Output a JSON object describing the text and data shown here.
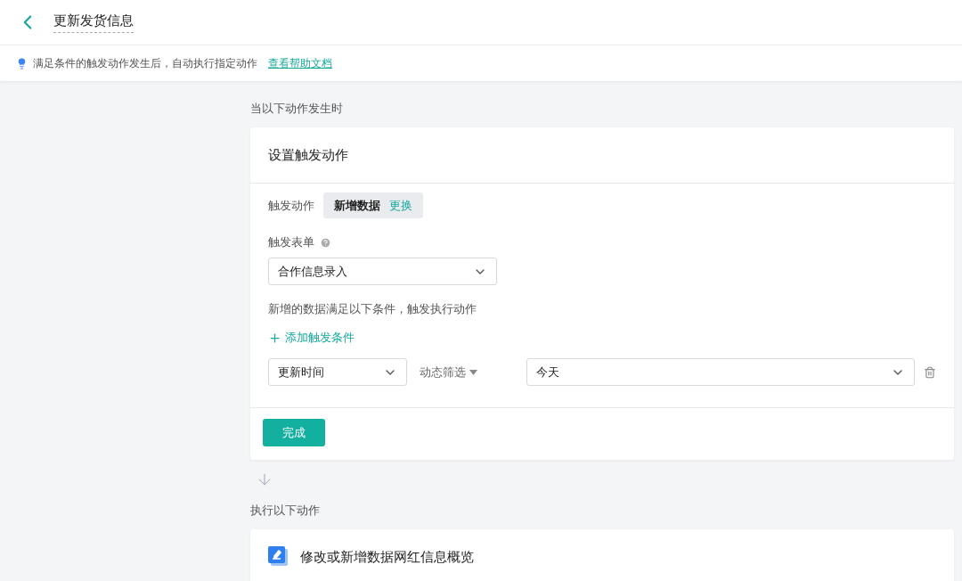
{
  "header": {
    "title": "更新发货信息"
  },
  "info_bar": {
    "text": "满足条件的触发动作发生后，自动执行指定动作",
    "link": "查看帮助文档"
  },
  "trigger_section": {
    "label": "当以下动作发生时",
    "card_title": "设置触发动作",
    "action_label": "触发动作",
    "action_value": "新增数据",
    "action_change": "更换",
    "form_label": "触发表单",
    "form_value": "合作信息录入",
    "condition_hint": "新增的数据满足以下条件，触发执行动作",
    "add_condition": "添加触发条件",
    "conditions": [
      {
        "field": "更新时间",
        "operator": "动态筛选",
        "value": "今天"
      }
    ],
    "done_button": "完成"
  },
  "action_section": {
    "label": "执行以下动作",
    "card_title": "修改或新增数据网红信息概览"
  }
}
